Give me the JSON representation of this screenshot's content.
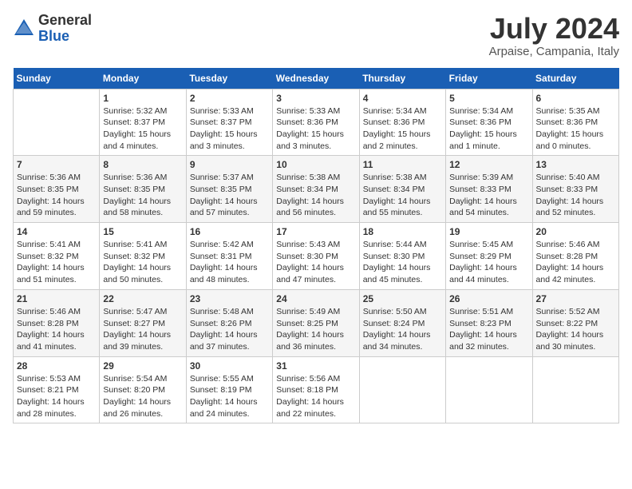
{
  "header": {
    "logo": {
      "general": "General",
      "blue": "Blue"
    },
    "title": "July 2024",
    "subtitle": "Arpaise, Campania, Italy"
  },
  "columns": [
    "Sunday",
    "Monday",
    "Tuesday",
    "Wednesday",
    "Thursday",
    "Friday",
    "Saturday"
  ],
  "weeks": [
    [
      {
        "num": "",
        "sunrise": "",
        "sunset": "",
        "daylight": ""
      },
      {
        "num": "1",
        "sunrise": "Sunrise: 5:32 AM",
        "sunset": "Sunset: 8:37 PM",
        "daylight": "Daylight: 15 hours and 4 minutes."
      },
      {
        "num": "2",
        "sunrise": "Sunrise: 5:33 AM",
        "sunset": "Sunset: 8:37 PM",
        "daylight": "Daylight: 15 hours and 3 minutes."
      },
      {
        "num": "3",
        "sunrise": "Sunrise: 5:33 AM",
        "sunset": "Sunset: 8:36 PM",
        "daylight": "Daylight: 15 hours and 3 minutes."
      },
      {
        "num": "4",
        "sunrise": "Sunrise: 5:34 AM",
        "sunset": "Sunset: 8:36 PM",
        "daylight": "Daylight: 15 hours and 2 minutes."
      },
      {
        "num": "5",
        "sunrise": "Sunrise: 5:34 AM",
        "sunset": "Sunset: 8:36 PM",
        "daylight": "Daylight: 15 hours and 1 minute."
      },
      {
        "num": "6",
        "sunrise": "Sunrise: 5:35 AM",
        "sunset": "Sunset: 8:36 PM",
        "daylight": "Daylight: 15 hours and 0 minutes."
      }
    ],
    [
      {
        "num": "7",
        "sunrise": "Sunrise: 5:36 AM",
        "sunset": "Sunset: 8:35 PM",
        "daylight": "Daylight: 14 hours and 59 minutes."
      },
      {
        "num": "8",
        "sunrise": "Sunrise: 5:36 AM",
        "sunset": "Sunset: 8:35 PM",
        "daylight": "Daylight: 14 hours and 58 minutes."
      },
      {
        "num": "9",
        "sunrise": "Sunrise: 5:37 AM",
        "sunset": "Sunset: 8:35 PM",
        "daylight": "Daylight: 14 hours and 57 minutes."
      },
      {
        "num": "10",
        "sunrise": "Sunrise: 5:38 AM",
        "sunset": "Sunset: 8:34 PM",
        "daylight": "Daylight: 14 hours and 56 minutes."
      },
      {
        "num": "11",
        "sunrise": "Sunrise: 5:38 AM",
        "sunset": "Sunset: 8:34 PM",
        "daylight": "Daylight: 14 hours and 55 minutes."
      },
      {
        "num": "12",
        "sunrise": "Sunrise: 5:39 AM",
        "sunset": "Sunset: 8:33 PM",
        "daylight": "Daylight: 14 hours and 54 minutes."
      },
      {
        "num": "13",
        "sunrise": "Sunrise: 5:40 AM",
        "sunset": "Sunset: 8:33 PM",
        "daylight": "Daylight: 14 hours and 52 minutes."
      }
    ],
    [
      {
        "num": "14",
        "sunrise": "Sunrise: 5:41 AM",
        "sunset": "Sunset: 8:32 PM",
        "daylight": "Daylight: 14 hours and 51 minutes."
      },
      {
        "num": "15",
        "sunrise": "Sunrise: 5:41 AM",
        "sunset": "Sunset: 8:32 PM",
        "daylight": "Daylight: 14 hours and 50 minutes."
      },
      {
        "num": "16",
        "sunrise": "Sunrise: 5:42 AM",
        "sunset": "Sunset: 8:31 PM",
        "daylight": "Daylight: 14 hours and 48 minutes."
      },
      {
        "num": "17",
        "sunrise": "Sunrise: 5:43 AM",
        "sunset": "Sunset: 8:30 PM",
        "daylight": "Daylight: 14 hours and 47 minutes."
      },
      {
        "num": "18",
        "sunrise": "Sunrise: 5:44 AM",
        "sunset": "Sunset: 8:30 PM",
        "daylight": "Daylight: 14 hours and 45 minutes."
      },
      {
        "num": "19",
        "sunrise": "Sunrise: 5:45 AM",
        "sunset": "Sunset: 8:29 PM",
        "daylight": "Daylight: 14 hours and 44 minutes."
      },
      {
        "num": "20",
        "sunrise": "Sunrise: 5:46 AM",
        "sunset": "Sunset: 8:28 PM",
        "daylight": "Daylight: 14 hours and 42 minutes."
      }
    ],
    [
      {
        "num": "21",
        "sunrise": "Sunrise: 5:46 AM",
        "sunset": "Sunset: 8:28 PM",
        "daylight": "Daylight: 14 hours and 41 minutes."
      },
      {
        "num": "22",
        "sunrise": "Sunrise: 5:47 AM",
        "sunset": "Sunset: 8:27 PM",
        "daylight": "Daylight: 14 hours and 39 minutes."
      },
      {
        "num": "23",
        "sunrise": "Sunrise: 5:48 AM",
        "sunset": "Sunset: 8:26 PM",
        "daylight": "Daylight: 14 hours and 37 minutes."
      },
      {
        "num": "24",
        "sunrise": "Sunrise: 5:49 AM",
        "sunset": "Sunset: 8:25 PM",
        "daylight": "Daylight: 14 hours and 36 minutes."
      },
      {
        "num": "25",
        "sunrise": "Sunrise: 5:50 AM",
        "sunset": "Sunset: 8:24 PM",
        "daylight": "Daylight: 14 hours and 34 minutes."
      },
      {
        "num": "26",
        "sunrise": "Sunrise: 5:51 AM",
        "sunset": "Sunset: 8:23 PM",
        "daylight": "Daylight: 14 hours and 32 minutes."
      },
      {
        "num": "27",
        "sunrise": "Sunrise: 5:52 AM",
        "sunset": "Sunset: 8:22 PM",
        "daylight": "Daylight: 14 hours and 30 minutes."
      }
    ],
    [
      {
        "num": "28",
        "sunrise": "Sunrise: 5:53 AM",
        "sunset": "Sunset: 8:21 PM",
        "daylight": "Daylight: 14 hours and 28 minutes."
      },
      {
        "num": "29",
        "sunrise": "Sunrise: 5:54 AM",
        "sunset": "Sunset: 8:20 PM",
        "daylight": "Daylight: 14 hours and 26 minutes."
      },
      {
        "num": "30",
        "sunrise": "Sunrise: 5:55 AM",
        "sunset": "Sunset: 8:19 PM",
        "daylight": "Daylight: 14 hours and 24 minutes."
      },
      {
        "num": "31",
        "sunrise": "Sunrise: 5:56 AM",
        "sunset": "Sunset: 8:18 PM",
        "daylight": "Daylight: 14 hours and 22 minutes."
      },
      {
        "num": "",
        "sunrise": "",
        "sunset": "",
        "daylight": ""
      },
      {
        "num": "",
        "sunrise": "",
        "sunset": "",
        "daylight": ""
      },
      {
        "num": "",
        "sunrise": "",
        "sunset": "",
        "daylight": ""
      }
    ]
  ]
}
